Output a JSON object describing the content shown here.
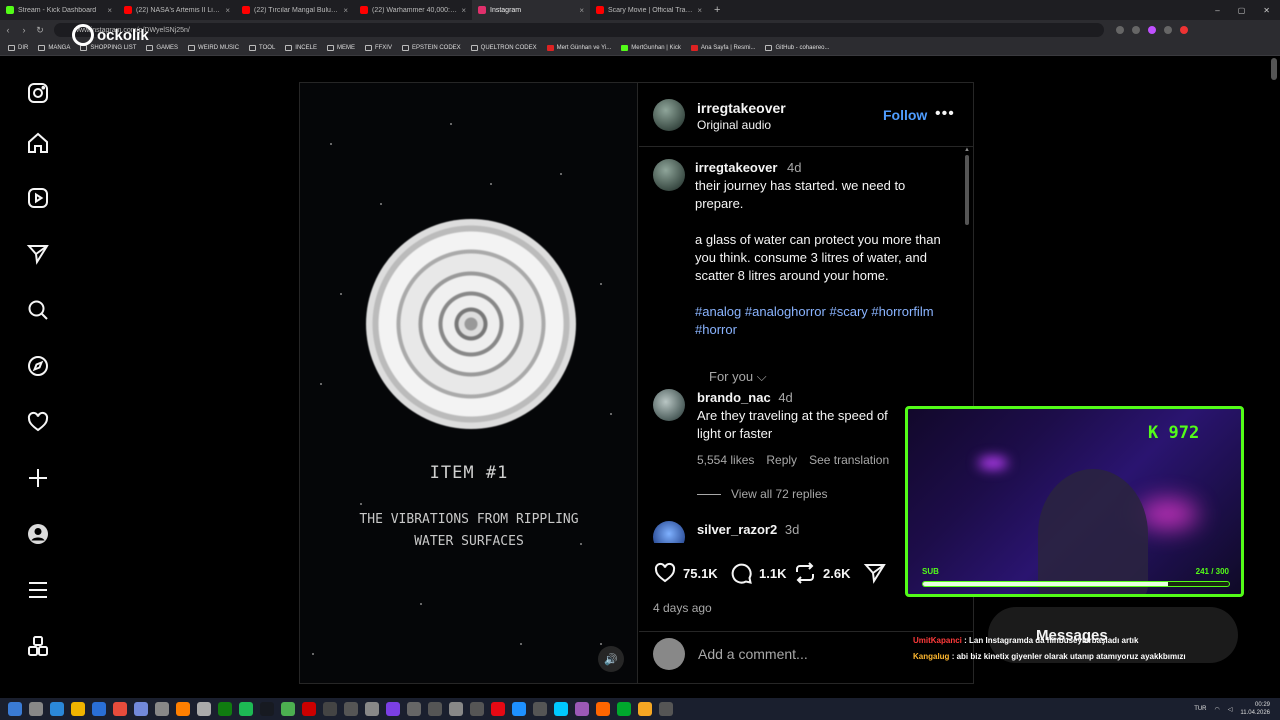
{
  "browser": {
    "tabs": [
      {
        "title": "Stream - Kick Dashboard",
        "color": "#53fc18"
      },
      {
        "title": "(22) NASA's Artemis II Live Views f",
        "color": "#ff0000"
      },
      {
        "title": "(22) Tırcılar Mangal Buluşması Ve",
        "color": "#ff0000"
      },
      {
        "title": "(22) Warhammer 40,000: Total Wa",
        "color": "#ff0000"
      },
      {
        "title": "Instagram",
        "color": "#e1306c"
      },
      {
        "title": "Scary Movie | Official Trailer | Para",
        "color": "#ff0000"
      }
    ],
    "new_tab": "+",
    "url": "www.instagram.com/p/DWyelSNj25n/",
    "bookmarks": [
      "DIR",
      "MANGA",
      "SHOPPING LIST",
      "GAMES",
      "WEIRD MUSIC",
      "TOOL",
      "INCELE",
      "MEME",
      "FFXIV",
      "EPSTEIN CODEX",
      "QUELTRON CODEX",
      "Mert Günhan ve Yi...",
      "MertGunhan | Kick",
      "Ana Sayfa | Resmi...",
      "GitHub - cohaereo..."
    ]
  },
  "logo_text": "ockolik",
  "post": {
    "media": {
      "title": "ITEM #1",
      "subtitle": "THE VIBRATIONS FROM RIPPLING WATER SURFACES"
    },
    "header": {
      "username": "irregtakeover",
      "audio": "Original audio",
      "follow_label": "Follow",
      "more": "•••"
    },
    "caption": {
      "username": "irregtakeover",
      "age": "4d",
      "line1": "their journey has started. we need to prepare.",
      "line2": "a glass of water can protect you more than you think. consume 3 litres of water, and scatter 8 litres around your home.",
      "tags": [
        "#analog",
        "#analoghorror",
        "#scary",
        "#horrorfilm",
        "#horror"
      ],
      "for_you": "For you"
    },
    "comments": [
      {
        "username": "brando_nac",
        "age": "4d",
        "text": "Are they traveling at the speed of light or faster",
        "likes": "5,554 likes",
        "reply": "Reply",
        "translate": "See translation",
        "view_replies": "View all 72 replies"
      },
      {
        "username": "silver_razor2",
        "age": "3d"
      }
    ],
    "actions": {
      "likes": "75.1K",
      "comments": "1.1K",
      "reposts": "2.6K",
      "posted": "4 days ago"
    },
    "add_comment_placeholder": "Add a comment..."
  },
  "overlay": {
    "kick_count": "972",
    "sub_label": "SUB",
    "sub_count": "241 / 300",
    "sub_progress": 0.8,
    "messages_label": "Messages",
    "chat": [
      {
        "user": "UmitKapanci",
        "text": ": Lan Instagramda da hinbuseylerbaşladı artık"
      },
      {
        "user": "Kangalug",
        "text": ": abi biz kinetix giyenler olarak utanıp atamıyoruz ayakkbımızı"
      }
    ]
  },
  "taskbar": {
    "lang": "TUR",
    "time": "00:29",
    "date": "11.04.2026"
  }
}
